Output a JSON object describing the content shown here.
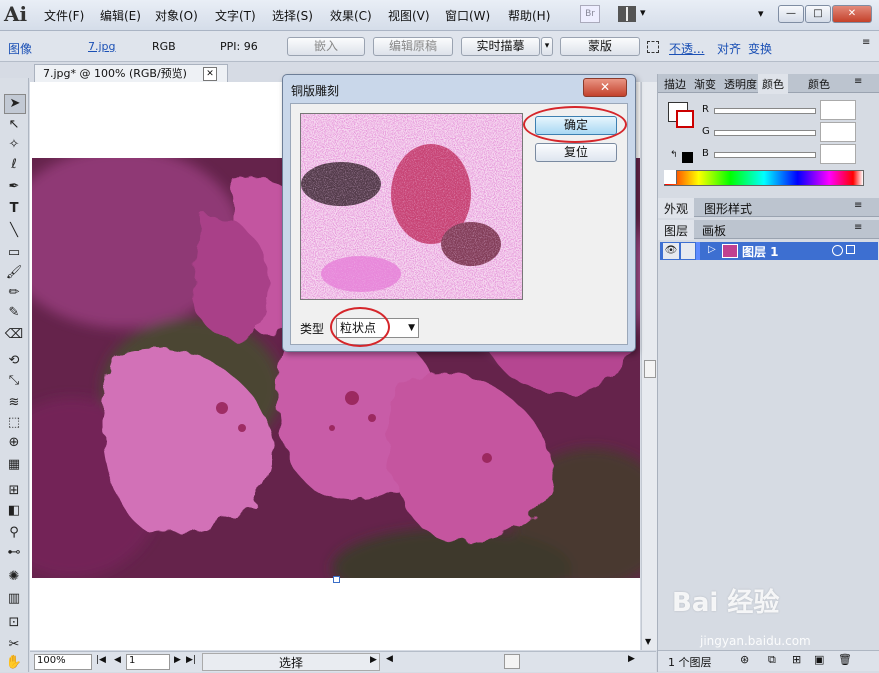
{
  "app": {
    "logo": "Ai",
    "bridge_label": "Br"
  },
  "menu": [
    "文件(F)",
    "编辑(E)",
    "对象(O)",
    "文字(T)",
    "选择(S)",
    "效果(C)",
    "视图(V)",
    "窗口(W)",
    "帮助(H)"
  ],
  "window_controls": {
    "dropdown": "▾",
    "minimize": "—",
    "maximize": "□",
    "close": "✕"
  },
  "control_bar": {
    "object_type": "图像",
    "filename": "7.jpg",
    "color_mode": "RGB",
    "ppi": "PPI: 96",
    "embed_label": "嵌入",
    "edit_original_label": "编辑原稿",
    "live_trace_label": "实时描摹",
    "mask_label": "蒙版",
    "opacity_label": "不透...",
    "align_label": "对齐",
    "transform_label": "变换"
  },
  "document": {
    "tab_title": "7.jpg* @ 100% (RGB/预览)",
    "tab_close": "✕"
  },
  "status": {
    "zoom": "100%",
    "page": "1",
    "mode": "选择"
  },
  "dialog": {
    "title": "铜版雕刻",
    "close": "✕",
    "ok_label": "确定",
    "reset_label": "复位",
    "type_label": "类型",
    "type_value": "粒状点"
  },
  "color_panel": {
    "tabs": [
      "描边",
      "渐变",
      "透明度",
      "颜色",
      "颜色"
    ],
    "channels": [
      "R",
      "G",
      "B"
    ],
    "values": [
      "",
      "",
      ""
    ]
  },
  "appearance_panel": {
    "tabs": [
      "外观",
      "图形样式"
    ]
  },
  "layers_panel": {
    "tabs": [
      "图层",
      "画板"
    ],
    "layer_name": "图层 1",
    "footer_count": "1 个图层"
  },
  "watermark": {
    "brand": "Bai 经验",
    "url": "jingyan.baidu.com"
  },
  "colors": {
    "accent": "#3d6fd1",
    "highlight_circle": "#d5262b",
    "flower_magenta": "#b5307f"
  }
}
